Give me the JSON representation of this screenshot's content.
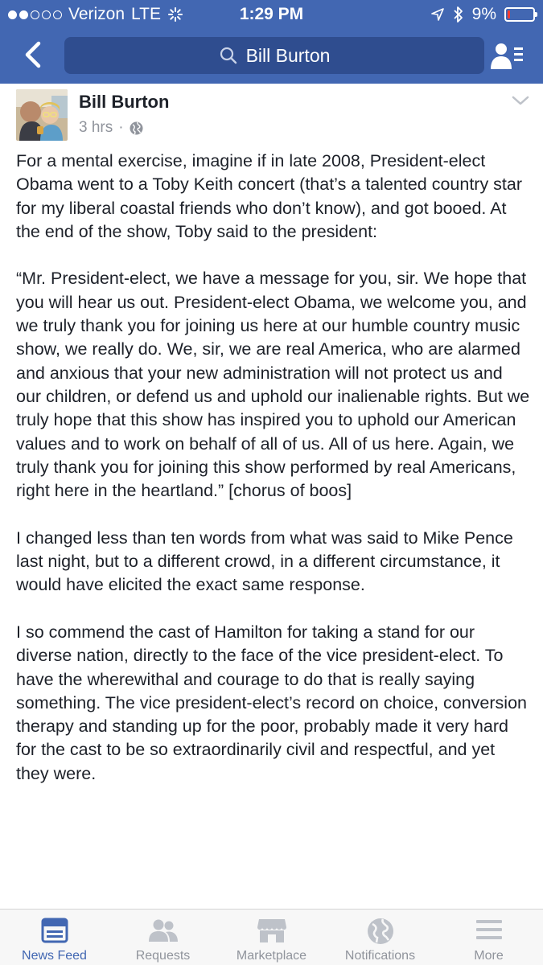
{
  "status_bar": {
    "carrier": "Verizon",
    "network": "LTE",
    "time": "1:29 PM",
    "battery": "9%",
    "battery_level": 0.09
  },
  "nav": {
    "search_value": "Bill Burton"
  },
  "post": {
    "author": "Bill Burton",
    "time": "3 hrs",
    "separator": "·",
    "paragraphs": [
      "For a mental exercise, imagine if in late 2008, President-elect Obama went to a Toby Keith concert (that’s a talented country star for my liberal coastal friends who don’t know), and got booed. At the end of the show, Toby said to the president:",
      "“Mr. President-elect, we have a message for you, sir. We hope that you will hear us out. President-elect Obama, we welcome you, and we truly thank you for joining us here at our humble country music show, we really do. We, sir, we are real America, who are alarmed and anxious that your new administration will not protect us and our children, or defend us and uphold our inalienable rights. But we truly hope that this show has inspired you to uphold our American values and to work on behalf of all of us. All of us here. Again, we truly thank you for joining this show performed by real Americans, right here in the heartland.” [chorus of boos]",
      "I changed less than ten words from what was said to Mike Pence last night, but to a different crowd, in a different circumstance, it would have elicited the exact same response.",
      "I so commend the cast of Hamilton for taking a stand for our diverse nation, directly to the face of the vice president-elect. To have the wherewithal and courage to do that is really saying something. The vice president-elect’s record on choice, conversion therapy and standing up for the poor, probably made it very hard for the cast to be so extraordinarily civil and respectful, and yet they were."
    ]
  },
  "tabs": [
    {
      "label": "News Feed",
      "icon": "news-feed-icon",
      "active": true
    },
    {
      "label": "Requests",
      "icon": "requests-icon",
      "active": false
    },
    {
      "label": "Marketplace",
      "icon": "marketplace-icon",
      "active": false
    },
    {
      "label": "Notifications",
      "icon": "globe-icon",
      "active": false
    },
    {
      "label": "More",
      "icon": "menu-icon",
      "active": false
    }
  ],
  "colors": {
    "brand_blue": "#4267b2",
    "search_bg": "#2f4d8f",
    "text": "#1d2129",
    "muted": "#90949c",
    "battery_low": "#ff3b30"
  }
}
